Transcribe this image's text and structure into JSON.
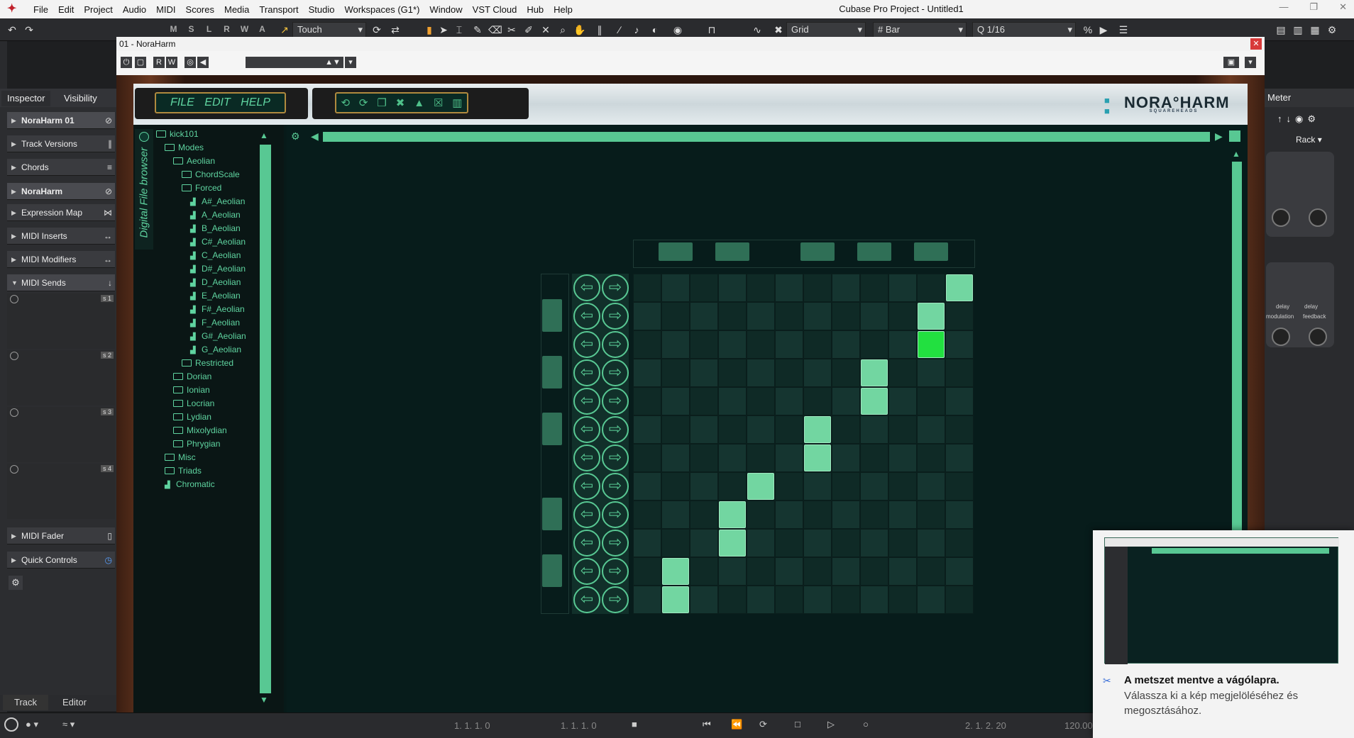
{
  "window": {
    "app_title": "Cubase Pro Project - Untitled1",
    "menu": [
      "File",
      "Edit",
      "Project",
      "Audio",
      "MIDI",
      "Scores",
      "Media",
      "Transport",
      "Studio",
      "Workspaces (G1*)",
      "Window",
      "VST Cloud",
      "Hub",
      "Help"
    ]
  },
  "toolbar": {
    "ms_buttons": [
      "M",
      "S",
      "L",
      "R",
      "W",
      "A"
    ],
    "automation_mode": "Touch",
    "snap_type": "Grid",
    "grid_type": "Bar",
    "quantize": "1/16"
  },
  "inspector": {
    "tabs": [
      "Inspector",
      "Visibility"
    ],
    "track_name": "NoraHarm 01",
    "sections": [
      "Track Versions",
      "Chords",
      "NoraHarm",
      "Expression Map",
      "MIDI Inserts",
      "MIDI Modifiers",
      "MIDI Sends",
      "MIDI Fader",
      "Quick Controls"
    ],
    "sends": [
      "s 1",
      "s 2",
      "s 3",
      "s 4"
    ],
    "bottom_tabs": [
      "Track",
      "Editor"
    ]
  },
  "plugin": {
    "window_title": "01 - NoraHarm",
    "menu_text": "FILE EDIT HELP",
    "brand": "NORA°HARM",
    "brand_sub": "SQUAREHEADS",
    "browser_label": "Digital File browser",
    "tree": [
      {
        "label": "kick101",
        "type": "folder",
        "depth": 0
      },
      {
        "label": "Modes",
        "type": "folder",
        "depth": 1
      },
      {
        "label": "Aeolian",
        "type": "folder",
        "depth": 2
      },
      {
        "label": "ChordScale",
        "type": "folder",
        "depth": 3
      },
      {
        "label": "Forced",
        "type": "folder",
        "depth": 3
      },
      {
        "label": "A#_Aeolian",
        "type": "scale",
        "depth": 4
      },
      {
        "label": "A_Aeolian",
        "type": "scale",
        "depth": 4
      },
      {
        "label": "B_Aeolian",
        "type": "scale",
        "depth": 4
      },
      {
        "label": "C#_Aeolian",
        "type": "scale",
        "depth": 4
      },
      {
        "label": "C_Aeolian",
        "type": "scale",
        "depth": 4
      },
      {
        "label": "D#_Aeolian",
        "type": "scale",
        "depth": 4
      },
      {
        "label": "D_Aeolian",
        "type": "scale",
        "depth": 4
      },
      {
        "label": "E_Aeolian",
        "type": "scale",
        "depth": 4
      },
      {
        "label": "F#_Aeolian",
        "type": "scale",
        "depth": 4
      },
      {
        "label": "F_Aeolian",
        "type": "scale",
        "depth": 4
      },
      {
        "label": "G#_Aeolian",
        "type": "scale",
        "depth": 4
      },
      {
        "label": "G_Aeolian",
        "type": "scale",
        "depth": 4
      },
      {
        "label": "Restricted",
        "type": "folder",
        "depth": 3
      },
      {
        "label": "Dorian",
        "type": "folder",
        "depth": 2
      },
      {
        "label": "Ionian",
        "type": "folder",
        "depth": 2
      },
      {
        "label": "Locrian",
        "type": "folder",
        "depth": 2
      },
      {
        "label": "Lydian",
        "type": "folder",
        "depth": 2
      },
      {
        "label": "Mixolydian",
        "type": "folder",
        "depth": 2
      },
      {
        "label": "Phrygian",
        "type": "folder",
        "depth": 2
      },
      {
        "label": "Misc",
        "type": "folder",
        "depth": 1
      },
      {
        "label": "Triads",
        "type": "folder",
        "depth": 1
      },
      {
        "label": "Chromatic",
        "type": "scale",
        "depth": 1
      }
    ],
    "grid": {
      "rows": 12,
      "cols": 12,
      "notes": [
        [
          0,
          11
        ],
        [
          1,
          10
        ],
        [
          2,
          10
        ],
        [
          3,
          8
        ],
        [
          4,
          8
        ],
        [
          5,
          6
        ],
        [
          6,
          6
        ],
        [
          7,
          4
        ],
        [
          8,
          3
        ],
        [
          9,
          3
        ],
        [
          10,
          1
        ],
        [
          11,
          1
        ]
      ],
      "active_note": [
        2,
        10
      ],
      "note_color": "#72d6a1",
      "active_color": "#22e040",
      "col_buttons": [
        1,
        3,
        6,
        8,
        10
      ],
      "row_buttons": [
        1,
        3,
        5,
        8,
        10
      ]
    }
  },
  "rack": {
    "title": "Meter",
    "rack_label": "Rack",
    "labels": [
      "delay",
      "delay",
      "modulation",
      "feedback"
    ]
  },
  "notification": {
    "title": "A metszet mentve a vágólapra.",
    "body": "Válassza ki a kép megjelöléséhez és megosztásához."
  },
  "transport": {
    "pos_left": "1. 1. 1. 0",
    "pos_right": "1. 1. 1. 0",
    "pos_main": "2. 1. 2. 20",
    "tempo": "120.000"
  }
}
